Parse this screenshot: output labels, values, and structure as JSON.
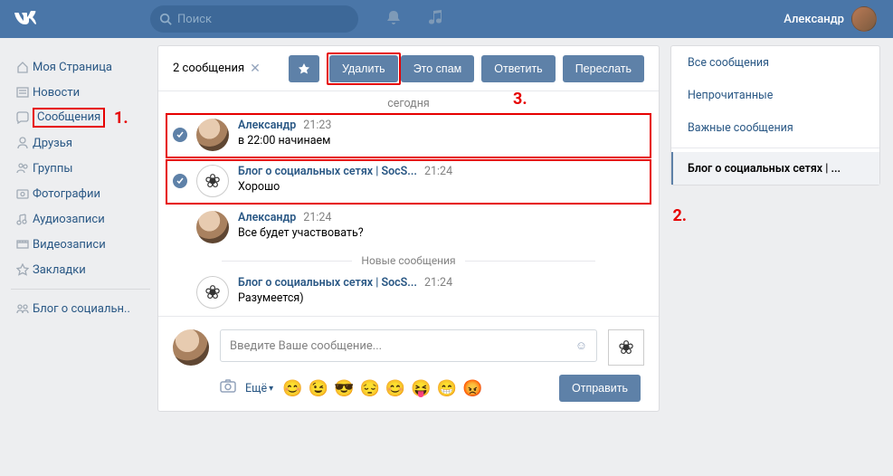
{
  "header": {
    "search_placeholder": "Поиск",
    "username": "Александр"
  },
  "nav": {
    "items": [
      {
        "label": "Моя Страница",
        "icon": "home"
      },
      {
        "label": "Новости",
        "icon": "news"
      },
      {
        "label": "Сообщения",
        "icon": "messages"
      },
      {
        "label": "Друзья",
        "icon": "friends"
      },
      {
        "label": "Группы",
        "icon": "groups"
      },
      {
        "label": "Фотографии",
        "icon": "photos"
      },
      {
        "label": "Аудиозаписи",
        "icon": "audio"
      },
      {
        "label": "Видеозаписи",
        "icon": "video"
      },
      {
        "label": "Закладки",
        "icon": "bookmarks"
      }
    ],
    "secondary": [
      {
        "label": "Блог о социальн..",
        "icon": "community"
      }
    ]
  },
  "toolbar": {
    "selection_label": "2 сообщения",
    "delete_label": "Удалить",
    "spam_label": "Это спам",
    "reply_label": "Ответить",
    "forward_label": "Переслать"
  },
  "thread": {
    "date_label": "сегодня",
    "new_divider": "Новые сообщения",
    "messages": [
      {
        "author": "Александр",
        "time": "21:23",
        "text": "в 22:00 начинаем",
        "avatar": "user"
      },
      {
        "author": "Блог о социальных сетях | SocS...",
        "time": "21:24",
        "text": "Хорошо",
        "avatar": "group"
      },
      {
        "author": "Александр",
        "time": "21:24",
        "text": "Все будет участвовать?",
        "avatar": "user"
      },
      {
        "author": "Блог о социальных сетях | SocS...",
        "time": "21:24",
        "text": "Разумеется)",
        "avatar": "group"
      }
    ]
  },
  "composer": {
    "placeholder": "Введите Ваше сообщение...",
    "more_label": "Ещё",
    "send_label": "Отправить"
  },
  "right": {
    "items": [
      "Все сообщения",
      "Непрочитанные",
      "Важные сообщения"
    ],
    "selected": "Блог о социальных сетях | ..."
  },
  "annotations": {
    "a1": "1.",
    "a2": "2.",
    "a3": "3."
  }
}
